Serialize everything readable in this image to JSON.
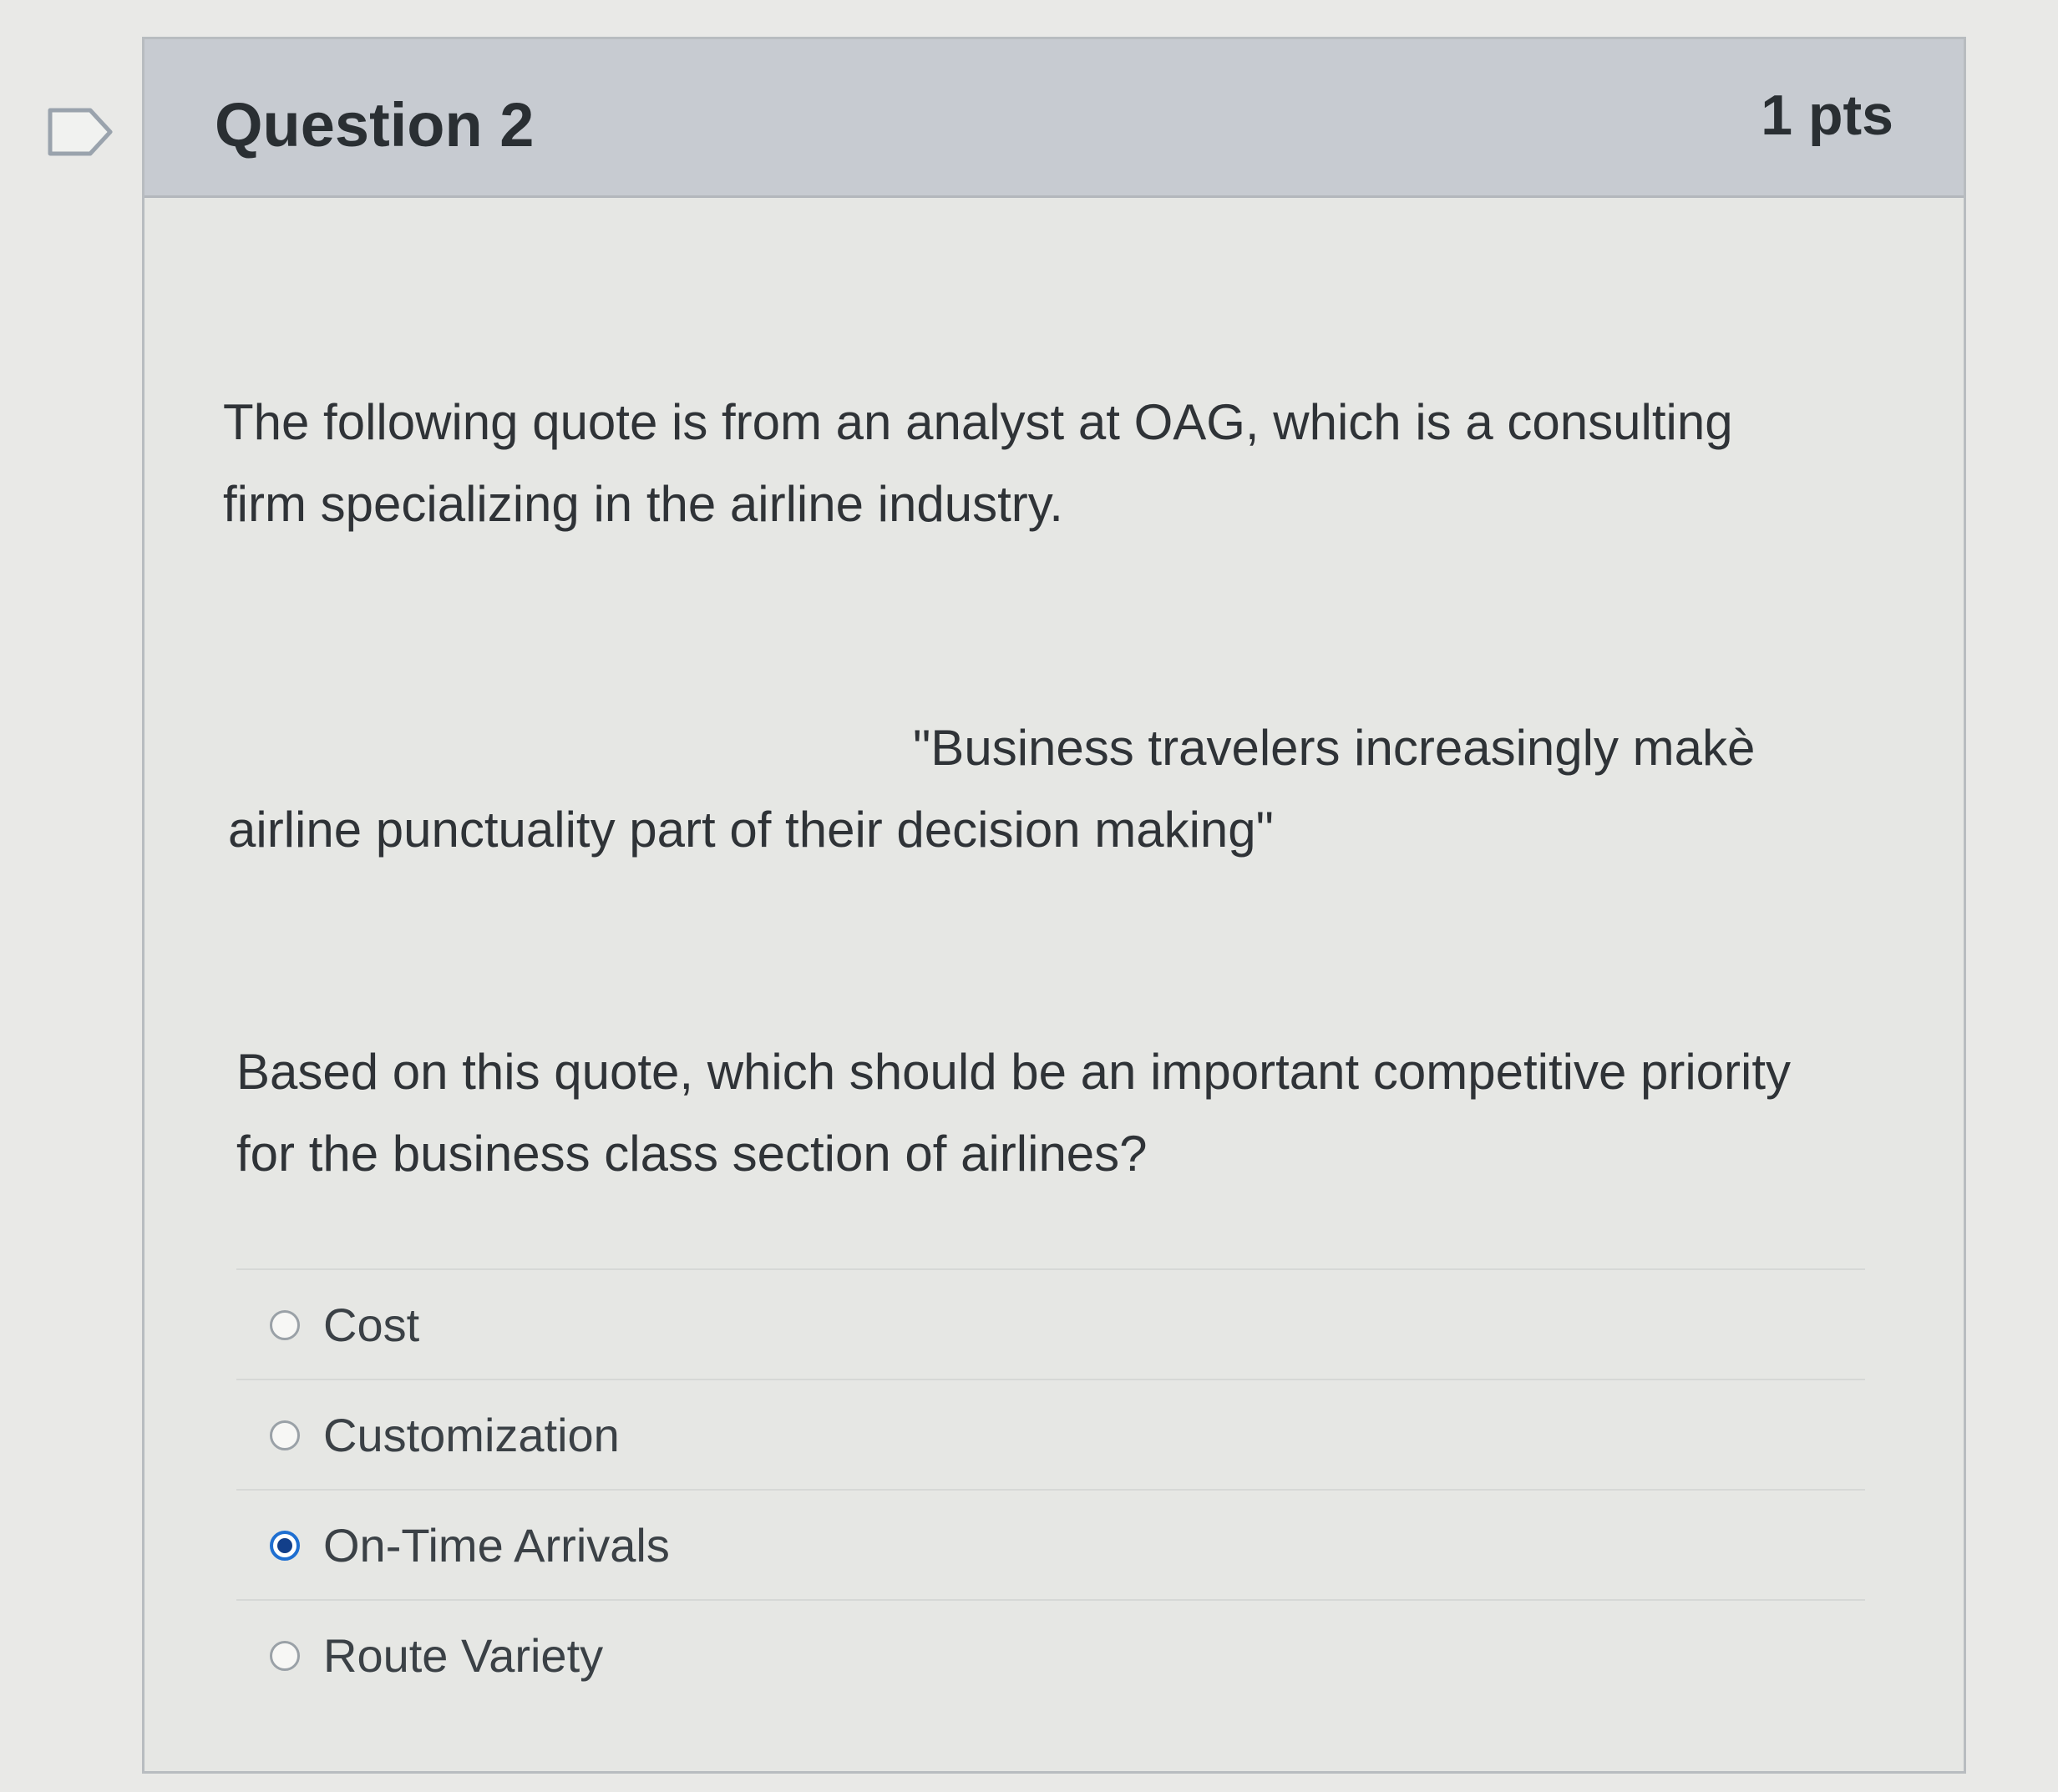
{
  "question": {
    "title": "Question 2",
    "points": "1 pts",
    "intro_lines": [
      "The following quote is from an analyst at OAG, which is a consulting",
      "firm specializing in the airline industry."
    ],
    "quote_lines": [
      "\"Business travelers increasingly makè",
      "airline punctuality part of their decision making\""
    ],
    "prompt_lines": [
      "Based on this quote, which should be an important competitive priority",
      "for the business class section of airlines?"
    ],
    "answers": [
      {
        "label": "Cost",
        "selected": false
      },
      {
        "label": "Customization",
        "selected": false
      },
      {
        "label": "On-Time Arrivals",
        "selected": true
      },
      {
        "label": "Route Variety",
        "selected": false
      }
    ]
  },
  "colors": {
    "header_bg": "#c7cbd1",
    "body_bg": "#e6e7e4",
    "selected_radio": "#1f6fd1"
  },
  "icons": {
    "flag": "flag-question-icon"
  }
}
